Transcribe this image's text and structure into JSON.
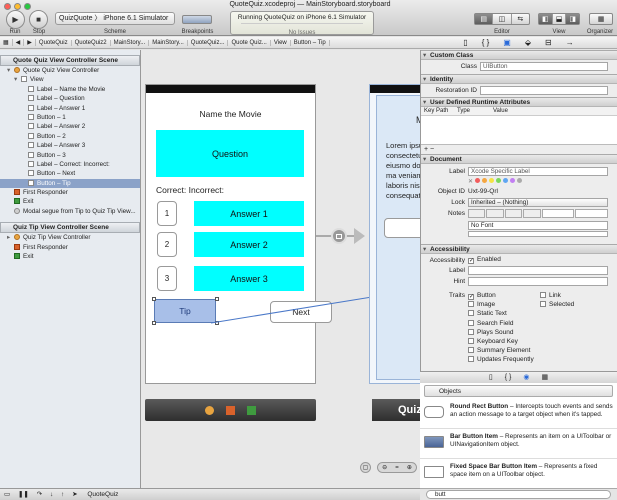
{
  "window": {
    "title": "QuoteQuiz.xcodeproj — MainStoryboard.storyboard"
  },
  "toolbar": {
    "run_label": "Run",
    "stop_label": "Stop",
    "scheme_value": "QuizQuote 〉 iPhone 6.1 Simulator",
    "scheme_label": "Scheme",
    "breakpoints_label": "Breakpoints",
    "status_text": "Running QuoteQuiz on iPhone 6.1 Simulator",
    "status_subtext": "No Issues",
    "editor_label": "Editor",
    "view_label": "View",
    "organizer_label": "Organizer"
  },
  "jumpbar": [
    "QuoteQuiz",
    "QuoteQuiz2",
    "MainStory...",
    "MainStory...",
    "QuoteQuiz...",
    "Quote Quiz...",
    "View",
    "Button – Tip"
  ],
  "outline": {
    "scene1_title": "Quote Quiz View Controller Scene",
    "scene1_items": [
      {
        "label": "Quote Quiz View Controller",
        "icon": "view-controller-icon",
        "indent": 1,
        "tri": "▾"
      },
      {
        "label": "View",
        "icon": "view-icon",
        "indent": 2,
        "tri": "▾"
      },
      {
        "label": "Label – Name the Movie",
        "icon": "label-icon",
        "indent": 3
      },
      {
        "label": "Label – Question",
        "icon": "label-icon",
        "indent": 3
      },
      {
        "label": "Label – Answer 1",
        "icon": "label-icon",
        "indent": 3
      },
      {
        "label": "Button – 1",
        "icon": "button-icon",
        "indent": 3
      },
      {
        "label": "Label – Answer 2",
        "icon": "label-icon",
        "indent": 3
      },
      {
        "label": "Button – 2",
        "icon": "button-icon",
        "indent": 3
      },
      {
        "label": "Label – Answer 3",
        "icon": "label-icon",
        "indent": 3
      },
      {
        "label": "Button – 3",
        "icon": "button-icon",
        "indent": 3
      },
      {
        "label": "Label – Correct: Incorrect:",
        "icon": "label-icon",
        "indent": 3
      },
      {
        "label": "Button – Next",
        "icon": "button-icon",
        "indent": 3
      },
      {
        "label": "Button – Tip",
        "icon": "button-icon",
        "indent": 3,
        "selected": true
      },
      {
        "label": "First Responder",
        "icon": "first-responder-icon",
        "indent": 1
      },
      {
        "label": "Exit",
        "icon": "exit-icon",
        "indent": 1
      },
      {
        "label": "Modal segue from Tip to Quiz Tip View...",
        "icon": "segue-icon",
        "indent": 1
      }
    ],
    "scene2_title": "Quiz Tip View Controller Scene",
    "scene2_items": [
      {
        "label": "Quiz Tip View Controller",
        "icon": "view-controller-icon",
        "indent": 1,
        "tri": "▸"
      },
      {
        "label": "First Responder",
        "icon": "first-responder-icon",
        "indent": 1
      },
      {
        "label": "Exit",
        "icon": "exit-icon",
        "indent": 1
      }
    ]
  },
  "scene1": {
    "title": "Name the Movie",
    "question": "Question",
    "score": "Correct: Incorrect:",
    "answers": [
      {
        "num": "1",
        "text": "Answer 1"
      },
      {
        "num": "2",
        "text": "Answer 2"
      },
      {
        "num": "3",
        "text": "Answer 3"
      }
    ],
    "tip": "Tip",
    "next": "Next"
  },
  "scene2": {
    "lorem": "Lorem ipsu consectetu do eiusmo dolore ma veniam, qu laboris nis consequat",
    "heading": "M",
    "partial_title": "Quiz"
  },
  "inspector": {
    "custom_class_head": "Custom Class",
    "class_label": "Class",
    "class_value": "UIButton",
    "identity_head": "Identity",
    "restoration_label": "Restoration ID",
    "runtime_head": "User Defined Runtime Attributes",
    "col_keypath": "Key Path",
    "col_type": "Type",
    "col_value": "Value",
    "document_head": "Document",
    "doc_label_label": "Label",
    "doc_label_placeholder": "Xcode Specific Label",
    "objectid_label": "Object ID",
    "objectid_value": "Uxt-99-Qrl",
    "lock_label": "Lock",
    "lock_value": "Inherited – (Nothing)",
    "notes_label": "Notes",
    "notes_font": "No Font",
    "accessibility_head": "Accessibility",
    "access_label": "Accessibility",
    "enabled_label": "Enabled",
    "acc_label_label": "Label",
    "hint_label": "Hint",
    "traits_label": "Traits",
    "traits": [
      {
        "label": "Button",
        "checked": true
      },
      {
        "label": "Link",
        "checked": false
      },
      {
        "label": "Image",
        "checked": false
      },
      {
        "label": "Selected",
        "checked": false
      },
      {
        "label": "Static Text",
        "checked": false
      },
      {
        "label": "Search Field",
        "checked": false
      },
      {
        "label": "Plays Sound",
        "checked": false
      },
      {
        "label": "Keyboard Key",
        "checked": false
      },
      {
        "label": "Summary Element",
        "checked": false
      },
      {
        "label": "Updates Frequently",
        "checked": false
      }
    ]
  },
  "library": {
    "selector_value": "Objects",
    "items": [
      {
        "name": "Round Rect Button",
        "desc": "Intercepts touch events and sends an action message to a target object when it's tapped."
      },
      {
        "name": "Bar Button Item",
        "desc": "Represents an item on a UIToolbar or UINavigationItem object."
      },
      {
        "name": "Fixed Space Bar Button Item",
        "desc": "Represents a fixed space item on a UIToolbar object."
      }
    ],
    "search_value": "butt"
  },
  "bottombar": {
    "target": "QuoteQuiz"
  },
  "colors": {
    "cyan": "#00ffff",
    "selection": "#8ba2c8",
    "tip_button": "#a8bfe8"
  }
}
